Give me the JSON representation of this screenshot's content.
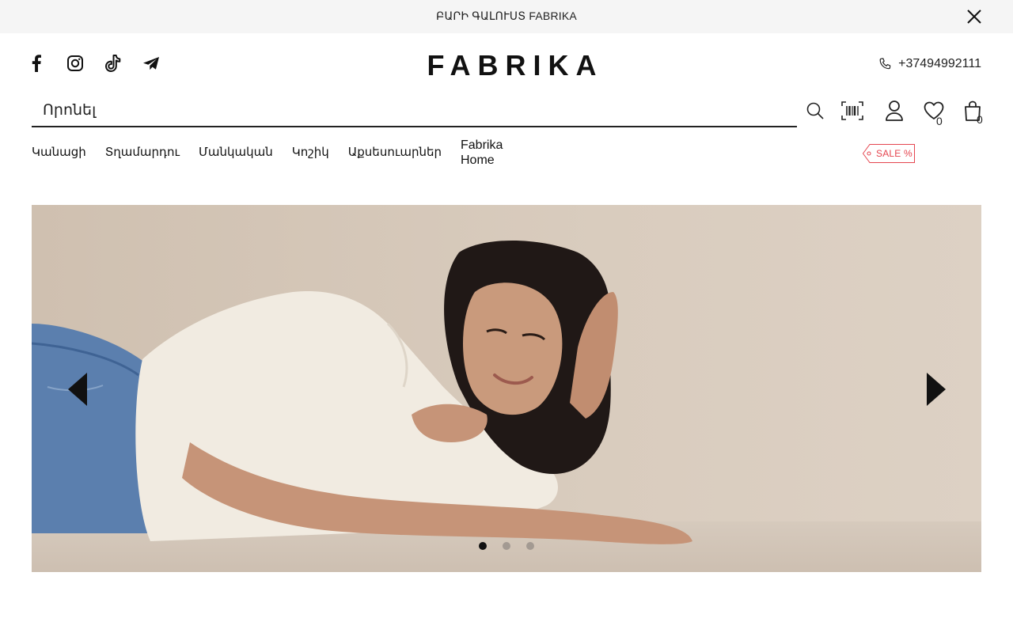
{
  "announcement": {
    "text": "ԲԱՐԻ ԳԱԼՈՒՍՏ FABRIKA"
  },
  "header": {
    "logo": "FABRIKA",
    "phone": "+37494992111",
    "social": [
      "facebook-icon",
      "instagram-icon",
      "tiktok-icon",
      "telegram-icon"
    ]
  },
  "search": {
    "placeholder": "Որոնել",
    "value": ""
  },
  "icons": {
    "wishlist_count": "0",
    "cart_count": "0"
  },
  "nav": {
    "items": [
      "Կանացի",
      "Տղամարդու",
      "Մանկական",
      "Կոշիկ",
      "Աքսեսուարներ"
    ],
    "home_line1": "Fabrika",
    "home_line2": "Home",
    "sale": "SALE %"
  },
  "hero": {
    "slide_count": 3,
    "active_slide": 1
  },
  "colors": {
    "accent": "#e5454f",
    "announcement_bg": "#f5f5f5",
    "hero_bg": "#d8cbbd",
    "text": "#111111"
  }
}
